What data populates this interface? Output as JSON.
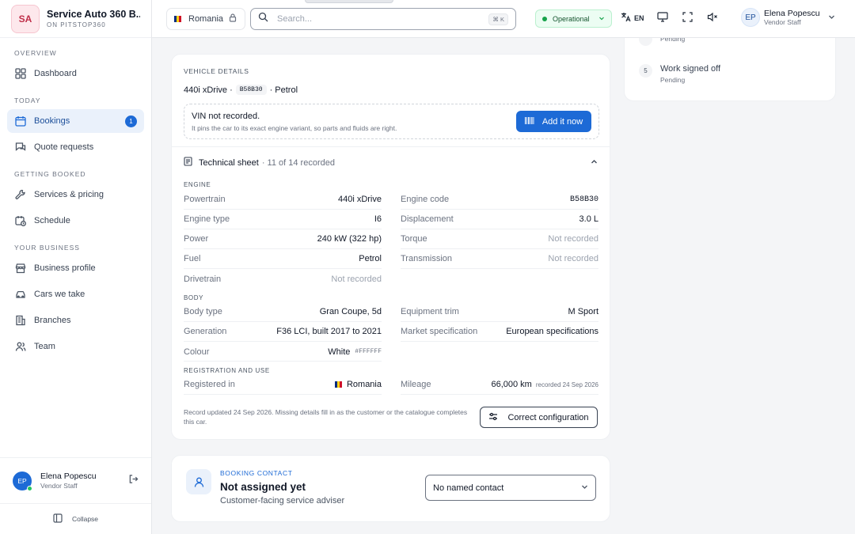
{
  "brand": {
    "initials": "SA",
    "name": "Service Auto 360 B...",
    "subtitle": "ON PITSTOP360"
  },
  "sidebar": {
    "sections": [
      {
        "label": "OVERVIEW",
        "items": [
          {
            "label": "Dashboard",
            "icon": "dashboard-icon"
          }
        ]
      },
      {
        "label": "TODAY",
        "items": [
          {
            "label": "Bookings",
            "icon": "calendar-icon",
            "badge": "1",
            "active": true
          },
          {
            "label": "Quote requests",
            "icon": "chat-icon"
          }
        ]
      },
      {
        "label": "GETTING BOOKED",
        "items": [
          {
            "label": "Services & pricing",
            "icon": "wrench-icon"
          },
          {
            "label": "Schedule",
            "icon": "calendar-clock-icon"
          }
        ]
      },
      {
        "label": "YOUR BUSINESS",
        "items": [
          {
            "label": "Business profile",
            "icon": "store-icon"
          },
          {
            "label": "Cars we take",
            "icon": "car-icon"
          },
          {
            "label": "Branches",
            "icon": "building-icon"
          },
          {
            "label": "Team",
            "icon": "users-icon"
          }
        ]
      }
    ],
    "user": {
      "initials": "EP",
      "name": "Elena Popescu",
      "role": "Vendor Staff"
    },
    "collapse_label": "Collapse"
  },
  "topbar": {
    "country": "Romania",
    "search_placeholder": "Search...",
    "shortcut": "⌘ K",
    "status": "Operational",
    "language": "EN",
    "user": {
      "initials": "EP",
      "name": "Elena Popescu",
      "role": "Vendor Staff"
    }
  },
  "steps": [
    {
      "num": "",
      "title": "",
      "status": "Pending"
    },
    {
      "num": "5",
      "title": "Work signed off",
      "status": "Pending"
    }
  ],
  "vehicle": {
    "section_label": "VEHICLE DETAILS",
    "model": "440i xDrive ·",
    "engine_code": "B58B30",
    "fuel_suffix": "· Petrol",
    "vin": {
      "title": "VIN not recorded.",
      "subtitle": "It pins the car to its exact engine variant, so parts and fluids are right.",
      "button": "Add it now"
    },
    "tech": {
      "title": "Technical sheet",
      "count": "· 11 of 14 recorded"
    },
    "groups": {
      "engine": "ENGINE",
      "body": "BODY",
      "registration": "REGISTRATION AND USE"
    },
    "engine_left": [
      {
        "k": "Powertrain",
        "v": "440i xDrive"
      },
      {
        "k": "Engine type",
        "v": "I6"
      },
      {
        "k": "Power",
        "v": "240 kW (322 hp)"
      },
      {
        "k": "Fuel",
        "v": "Petrol"
      },
      {
        "k": "Drivetrain",
        "v": "Not recorded"
      }
    ],
    "engine_right": [
      {
        "k": "Engine code",
        "v": "B58B30"
      },
      {
        "k": "Displacement",
        "v": "3.0 L"
      },
      {
        "k": "Torque",
        "v": "Not recorded"
      },
      {
        "k": "Transmission",
        "v": "Not recorded"
      }
    ],
    "body_left": [
      {
        "k": "Body type",
        "v": "Gran Coupe, 5d"
      },
      {
        "k": "Generation",
        "v": "F36 LCI, built 2017 to 2021"
      },
      {
        "k": "Colour",
        "v": "White",
        "hex": "#FFFFFF"
      }
    ],
    "body_right": [
      {
        "k": "Equipment trim",
        "v": "M Sport"
      },
      {
        "k": "Market specification",
        "v": "European specifications"
      }
    ],
    "registration": {
      "k": "Registered in",
      "v": "Romania"
    },
    "mileage": {
      "k": "Mileage",
      "v": "66,000 km",
      "note": "recorded 24 Sep 2026"
    },
    "footnote": "Record updated 24 Sep 2026. Missing details fill in as the customer or the catalogue completes this car.",
    "correct_button": "Correct configuration"
  },
  "contact": {
    "label": "BOOKING CONTACT",
    "title": "Not assigned yet",
    "subtitle": "Customer-facing service adviser",
    "select_value": "No named contact"
  },
  "colors": {
    "accent": "#1d6ad6",
    "status_green": "#16a34a",
    "brand_pink": "#fde8ec",
    "flag_blue": "#002b7f",
    "flag_yellow": "#fcd116",
    "flag_red": "#ce1126"
  }
}
